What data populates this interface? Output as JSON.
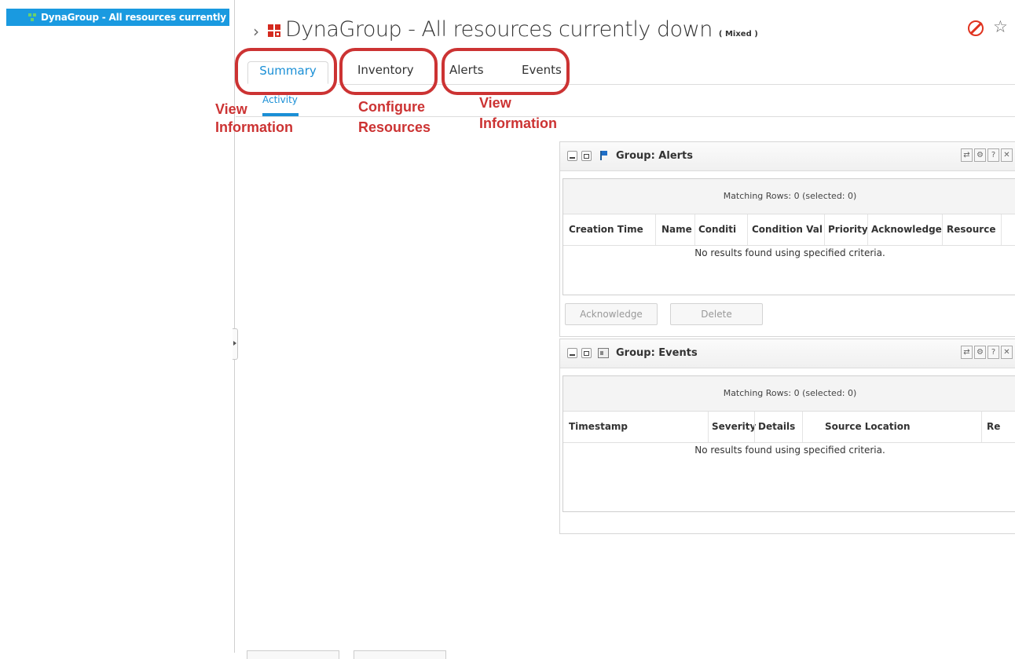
{
  "tree": {
    "selected_label": "DynaGroup - All resources currently d"
  },
  "header": {
    "breadcrumb_chevron": "›",
    "title": "DynaGroup - All resources currently down",
    "title_suffix": "( Mixed )",
    "star_glyph": "☆"
  },
  "tabs": [
    {
      "label": "Summary",
      "active": true
    },
    {
      "label": "Inventory"
    },
    {
      "label": "Alerts"
    },
    {
      "label": "Events"
    }
  ],
  "subtab": {
    "label": "Activity"
  },
  "annotations": {
    "a1_line1": "View",
    "a1_line2": "Information",
    "a2_line1": "Configure",
    "a2_line2": "Resources",
    "a3_line1": "View",
    "a3_line2": "Information",
    "color": "#cc3333"
  },
  "alerts_portlet": {
    "title": "Group: Alerts",
    "matching": "Matching Rows: 0 (selected: 0)",
    "columns": [
      "Creation Time",
      "Name",
      "Conditi",
      "Condition Val",
      "Priority",
      "Acknowledge",
      "Resource"
    ],
    "empty": "No results found using specified criteria.",
    "buttons": {
      "acknowledge": "Acknowledge",
      "delete": "Delete"
    },
    "controls": [
      "⇄",
      "⚙",
      "?",
      "✕"
    ]
  },
  "events_portlet": {
    "title": "Group: Events",
    "matching": "Matching Rows: 0 (selected: 0)",
    "columns": [
      "Timestamp",
      "Severity",
      "Details",
      "Source Location",
      "Re"
    ],
    "empty": "No results found using specified criteria.",
    "controls": [
      "⇄",
      "⚙",
      "?",
      "✕"
    ]
  },
  "colors": {
    "accent": "#1a8fd6",
    "tree_selected": "#1a9ae0",
    "group_icon": "#d42a1f",
    "no_icon": "#e0331f"
  }
}
